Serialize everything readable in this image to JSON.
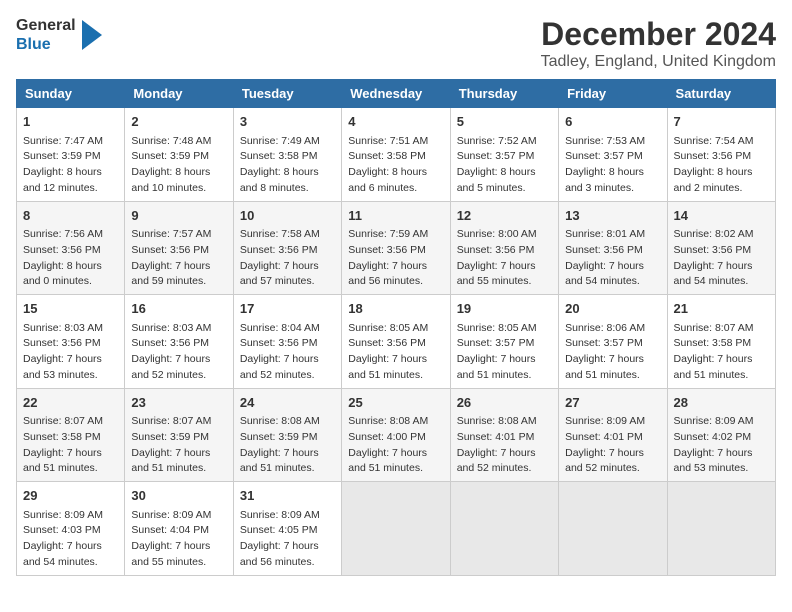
{
  "logo": {
    "line1": "General",
    "line2": "Blue"
  },
  "title": "December 2024",
  "subtitle": "Tadley, England, United Kingdom",
  "days_of_week": [
    "Sunday",
    "Monday",
    "Tuesday",
    "Wednesday",
    "Thursday",
    "Friday",
    "Saturday"
  ],
  "weeks": [
    [
      {
        "day": 1,
        "info": "Sunrise: 7:47 AM\nSunset: 3:59 PM\nDaylight: 8 hours\nand 12 minutes."
      },
      {
        "day": 2,
        "info": "Sunrise: 7:48 AM\nSunset: 3:59 PM\nDaylight: 8 hours\nand 10 minutes."
      },
      {
        "day": 3,
        "info": "Sunrise: 7:49 AM\nSunset: 3:58 PM\nDaylight: 8 hours\nand 8 minutes."
      },
      {
        "day": 4,
        "info": "Sunrise: 7:51 AM\nSunset: 3:58 PM\nDaylight: 8 hours\nand 6 minutes."
      },
      {
        "day": 5,
        "info": "Sunrise: 7:52 AM\nSunset: 3:57 PM\nDaylight: 8 hours\nand 5 minutes."
      },
      {
        "day": 6,
        "info": "Sunrise: 7:53 AM\nSunset: 3:57 PM\nDaylight: 8 hours\nand 3 minutes."
      },
      {
        "day": 7,
        "info": "Sunrise: 7:54 AM\nSunset: 3:56 PM\nDaylight: 8 hours\nand 2 minutes."
      }
    ],
    [
      {
        "day": 8,
        "info": "Sunrise: 7:56 AM\nSunset: 3:56 PM\nDaylight: 8 hours\nand 0 minutes."
      },
      {
        "day": 9,
        "info": "Sunrise: 7:57 AM\nSunset: 3:56 PM\nDaylight: 7 hours\nand 59 minutes."
      },
      {
        "day": 10,
        "info": "Sunrise: 7:58 AM\nSunset: 3:56 PM\nDaylight: 7 hours\nand 57 minutes."
      },
      {
        "day": 11,
        "info": "Sunrise: 7:59 AM\nSunset: 3:56 PM\nDaylight: 7 hours\nand 56 minutes."
      },
      {
        "day": 12,
        "info": "Sunrise: 8:00 AM\nSunset: 3:56 PM\nDaylight: 7 hours\nand 55 minutes."
      },
      {
        "day": 13,
        "info": "Sunrise: 8:01 AM\nSunset: 3:56 PM\nDaylight: 7 hours\nand 54 minutes."
      },
      {
        "day": 14,
        "info": "Sunrise: 8:02 AM\nSunset: 3:56 PM\nDaylight: 7 hours\nand 54 minutes."
      }
    ],
    [
      {
        "day": 15,
        "info": "Sunrise: 8:03 AM\nSunset: 3:56 PM\nDaylight: 7 hours\nand 53 minutes."
      },
      {
        "day": 16,
        "info": "Sunrise: 8:03 AM\nSunset: 3:56 PM\nDaylight: 7 hours\nand 52 minutes."
      },
      {
        "day": 17,
        "info": "Sunrise: 8:04 AM\nSunset: 3:56 PM\nDaylight: 7 hours\nand 52 minutes."
      },
      {
        "day": 18,
        "info": "Sunrise: 8:05 AM\nSunset: 3:56 PM\nDaylight: 7 hours\nand 51 minutes."
      },
      {
        "day": 19,
        "info": "Sunrise: 8:05 AM\nSunset: 3:57 PM\nDaylight: 7 hours\nand 51 minutes."
      },
      {
        "day": 20,
        "info": "Sunrise: 8:06 AM\nSunset: 3:57 PM\nDaylight: 7 hours\nand 51 minutes."
      },
      {
        "day": 21,
        "info": "Sunrise: 8:07 AM\nSunset: 3:58 PM\nDaylight: 7 hours\nand 51 minutes."
      }
    ],
    [
      {
        "day": 22,
        "info": "Sunrise: 8:07 AM\nSunset: 3:58 PM\nDaylight: 7 hours\nand 51 minutes."
      },
      {
        "day": 23,
        "info": "Sunrise: 8:07 AM\nSunset: 3:59 PM\nDaylight: 7 hours\nand 51 minutes."
      },
      {
        "day": 24,
        "info": "Sunrise: 8:08 AM\nSunset: 3:59 PM\nDaylight: 7 hours\nand 51 minutes."
      },
      {
        "day": 25,
        "info": "Sunrise: 8:08 AM\nSunset: 4:00 PM\nDaylight: 7 hours\nand 51 minutes."
      },
      {
        "day": 26,
        "info": "Sunrise: 8:08 AM\nSunset: 4:01 PM\nDaylight: 7 hours\nand 52 minutes."
      },
      {
        "day": 27,
        "info": "Sunrise: 8:09 AM\nSunset: 4:01 PM\nDaylight: 7 hours\nand 52 minutes."
      },
      {
        "day": 28,
        "info": "Sunrise: 8:09 AM\nSunset: 4:02 PM\nDaylight: 7 hours\nand 53 minutes."
      }
    ],
    [
      {
        "day": 29,
        "info": "Sunrise: 8:09 AM\nSunset: 4:03 PM\nDaylight: 7 hours\nand 54 minutes."
      },
      {
        "day": 30,
        "info": "Sunrise: 8:09 AM\nSunset: 4:04 PM\nDaylight: 7 hours\nand 55 minutes."
      },
      {
        "day": 31,
        "info": "Sunrise: 8:09 AM\nSunset: 4:05 PM\nDaylight: 7 hours\nand 56 minutes."
      },
      null,
      null,
      null,
      null
    ]
  ]
}
